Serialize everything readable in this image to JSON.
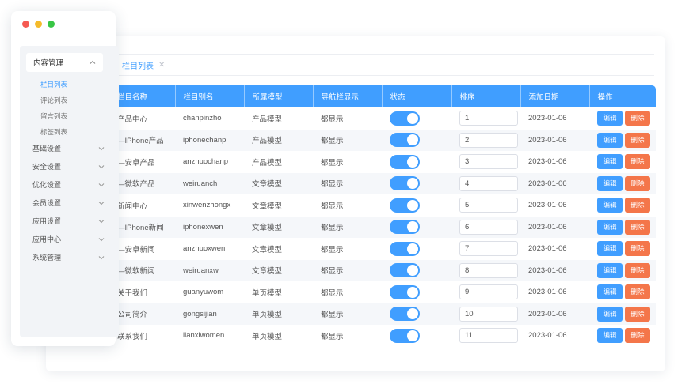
{
  "window": {
    "controls": [
      "close",
      "minimize",
      "maximize"
    ]
  },
  "sidebar": {
    "open_menu": {
      "label": "内容管理",
      "icon": "chevron-up-icon"
    },
    "sub_items": [
      {
        "label": "栏目列表",
        "active": true
      },
      {
        "label": "评论列表",
        "active": false
      },
      {
        "label": "留言列表",
        "active": false
      },
      {
        "label": "标签列表",
        "active": false
      }
    ],
    "menus": [
      {
        "label": "基础设置",
        "icon": "chevron-down-icon"
      },
      {
        "label": "安全设置",
        "icon": "chevron-down-icon"
      },
      {
        "label": "优化设置",
        "icon": "chevron-down-icon"
      },
      {
        "label": "会员设置",
        "icon": "chevron-down-icon"
      },
      {
        "label": "应用设置",
        "icon": "chevron-down-icon"
      },
      {
        "label": "应用中心",
        "icon": "chevron-down-icon"
      },
      {
        "label": "系统管理",
        "icon": "chevron-down-icon"
      }
    ]
  },
  "tabs": [
    {
      "label": "栏目列表",
      "active": true
    }
  ],
  "table": {
    "columns": [
      "栏目名称",
      "栏目别名",
      "所属模型",
      "导航栏显示",
      "状态",
      "排序",
      "添加日期",
      "操作"
    ],
    "edit_label": "编辑",
    "delete_label": "删除",
    "rows": [
      {
        "name": "产品中心",
        "alias": "chanpinzho",
        "model": "产品模型",
        "nav": "都显示",
        "status_on": true,
        "sort": "1",
        "date": "2023-01-06"
      },
      {
        "name": "—IPhone产品",
        "alias": "iphonechanp",
        "model": "产品模型",
        "nav": "都显示",
        "status_on": true,
        "sort": "2",
        "date": "2023-01-06"
      },
      {
        "name": "—安卓产品",
        "alias": "anzhuochanp",
        "model": "产品模型",
        "nav": "都显示",
        "status_on": true,
        "sort": "3",
        "date": "2023-01-06"
      },
      {
        "name": "—微软产品",
        "alias": "weiruanch",
        "model": "文章模型",
        "nav": "都显示",
        "status_on": true,
        "sort": "4",
        "date": "2023-01-06"
      },
      {
        "name": "新闻中心",
        "alias": "xinwenzhongx",
        "model": "文章模型",
        "nav": "都显示",
        "status_on": true,
        "sort": "5",
        "date": "2023-01-06"
      },
      {
        "name": "—IPhone新闻",
        "alias": "iphonexwen",
        "model": "文章模型",
        "nav": "都显示",
        "status_on": true,
        "sort": "6",
        "date": "2023-01-06"
      },
      {
        "name": "—安卓新闻",
        "alias": "anzhuoxwen",
        "model": "文章模型",
        "nav": "都显示",
        "status_on": true,
        "sort": "7",
        "date": "2023-01-06"
      },
      {
        "name": "—微软新闻",
        "alias": "weiruanxw",
        "model": "文章模型",
        "nav": "都显示",
        "status_on": true,
        "sort": "8",
        "date": "2023-01-06"
      },
      {
        "name": "关于我们",
        "alias": "guanyuwom",
        "model": "单页模型",
        "nav": "都显示",
        "status_on": true,
        "sort": "9",
        "date": "2023-01-06"
      },
      {
        "name": "公司简介",
        "alias": "gongsijian",
        "model": "单页模型",
        "nav": "都显示",
        "status_on": true,
        "sort": "10",
        "date": "2023-01-06"
      },
      {
        "name": "联系我们",
        "alias": "lianxiwomen",
        "model": "单页模型",
        "nav": "都显示",
        "status_on": true,
        "sort": "11",
        "date": "2023-01-06"
      }
    ]
  },
  "colors": {
    "primary": "#409eff",
    "danger": "#f4764a",
    "sidebar_bg": "#f2f4f7"
  }
}
